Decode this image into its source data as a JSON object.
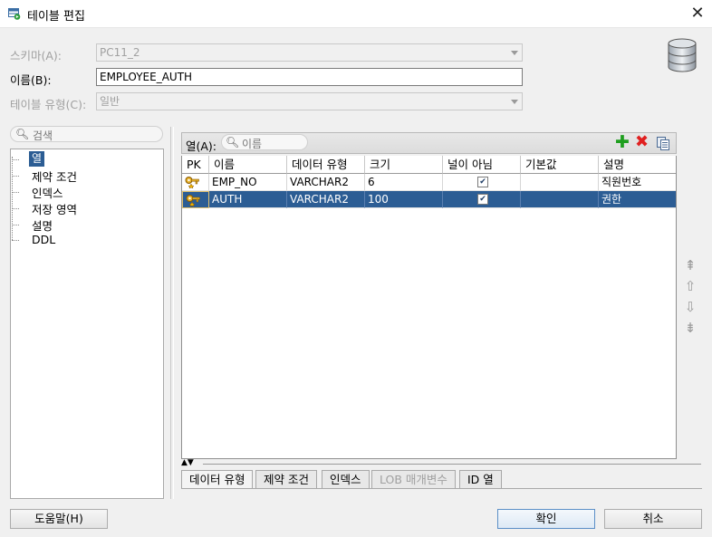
{
  "window": {
    "title": "테이블 편집",
    "close_glyph": "✕"
  },
  "form": {
    "schema_label": "스키마(A):",
    "schema_value": "PC11_2",
    "name_label": "이름(B):",
    "name_value": "EMPLOYEE_AUTH",
    "type_label": "테이블 유형(C):",
    "type_value": "일반"
  },
  "left_search": {
    "placeholder": "검색"
  },
  "tree": {
    "items": [
      {
        "label": "열",
        "selected": true
      },
      {
        "label": "제약 조건"
      },
      {
        "label": "인덱스"
      },
      {
        "label": "저장 영역"
      },
      {
        "label": "설명"
      },
      {
        "label": "DDL"
      }
    ]
  },
  "columns_panel": {
    "label": "열(A):",
    "search_placeholder": "이름",
    "toolbar": {
      "add_icon": "add-icon",
      "delete_icon": "delete-icon",
      "copy_icon": "copy-icon"
    },
    "headers": [
      "PK",
      "이름",
      "데이터 유형",
      "크기",
      "널이 아님",
      "기본값",
      "설명"
    ],
    "rows": [
      {
        "pk_icon": "key-icon",
        "name": "EMP_NO",
        "type": "VARCHAR2",
        "size": "6",
        "not_null": true,
        "default": "",
        "description": "직원번호",
        "selected": false
      },
      {
        "pk_icon": "key-star-icon",
        "name": "AUTH",
        "type": "VARCHAR2",
        "size": "100",
        "not_null": true,
        "default": "",
        "description": "권한",
        "selected": true
      }
    ]
  },
  "bottom_tabs": [
    {
      "label": "데이터 유형",
      "enabled": true
    },
    {
      "label": "제약 조건",
      "enabled": true
    },
    {
      "label": "인덱스",
      "enabled": true
    },
    {
      "label": "LOB 매개변수",
      "enabled": false
    },
    {
      "label": "ID 열",
      "enabled": true
    }
  ],
  "buttons": {
    "help": "도움말(H)",
    "ok": "확인",
    "cancel": "취소"
  },
  "colors": {
    "selection": "#2c5d94",
    "add": "#1e9e1e",
    "delete": "#e02020"
  }
}
